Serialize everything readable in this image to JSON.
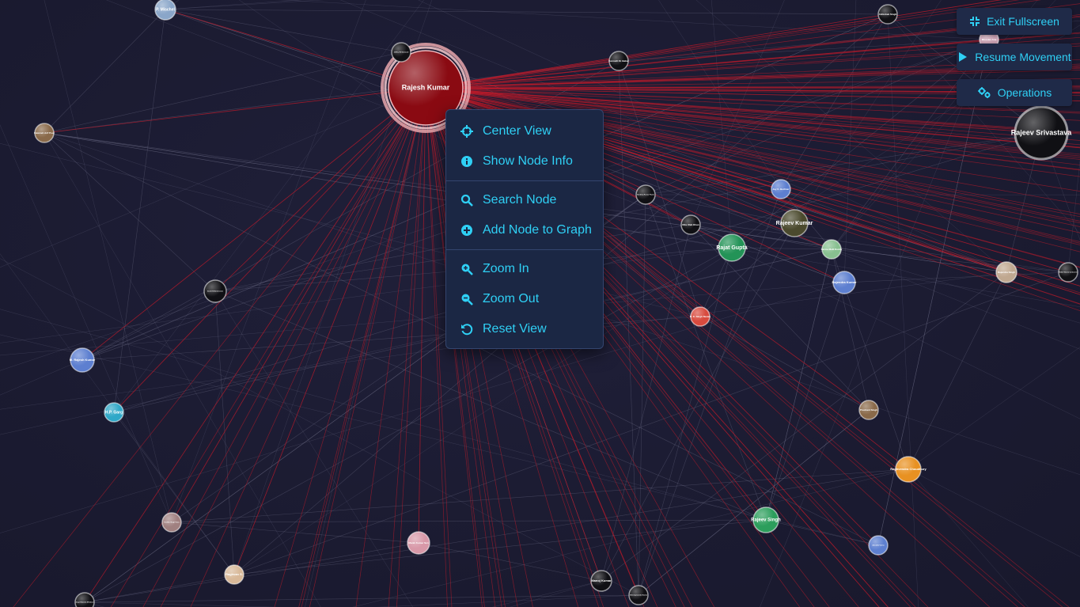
{
  "controls": {
    "exit_fullscreen": "Exit Fullscreen",
    "resume_movement": "Resume Movement",
    "operations": "Operations"
  },
  "context_menu": {
    "center_view": "Center View",
    "show_node_info": "Show Node Info",
    "search_node": "Search Node",
    "add_node": "Add Node to Graph",
    "zoom_in": "Zoom In",
    "zoom_out": "Zoom Out",
    "reset_view": "Reset View"
  },
  "selected_node": "Rajesh Kumar",
  "colors": {
    "accent": "#2fd0f5",
    "selected": "#8a0a12",
    "edge_highlight": "#c41a2a",
    "edge_default": "#7d7f99"
  },
  "nodes": [
    {
      "label": "Rajesh Kumar",
      "color": "#8a0a12"
    },
    {
      "label": "Rajeev Srivastava",
      "color": "#101014"
    },
    {
      "label": "P. Mischel",
      "color": "#8aa6c9"
    },
    {
      "label": "Abhishek Singh",
      "color": "#101014"
    },
    {
      "label": "Miroslav Ana",
      "color": "#c9a0b2"
    },
    {
      "label": "Jeffery M. Diamond",
      "color": "#101014"
    },
    {
      "label": "Kenneth M. Baker",
      "color": "#101014"
    },
    {
      "label": "Fatemeh Arif Pour",
      "color": "#8a6a4a"
    },
    {
      "label": "Sandeep Kumar Pawar",
      "color": "#101014"
    },
    {
      "label": "Jay K. Berliner",
      "color": "#5d7fd0"
    },
    {
      "label": "Rita Ulah Khan",
      "color": "#101014"
    },
    {
      "label": "Rajeev Kumar",
      "color": "#4b4a2e"
    },
    {
      "label": "Rajat Gupta",
      "color": "#239357"
    },
    {
      "label": "Sarma Malli Reddy",
      "color": "#88c090"
    },
    {
      "label": "Rajendra Kumar",
      "color": "#5d7fd0"
    },
    {
      "label": "Rajendra Singh",
      "color": "#c0a890"
    },
    {
      "label": "Rafael Garcia Carbonero",
      "color": "#101014"
    },
    {
      "label": "Asmit Srikanteswara",
      "color": "#101014"
    },
    {
      "label": "M. Rajesh Kumar",
      "color": "#5d7fd0"
    },
    {
      "label": "H.P. Garg",
      "color": "#2fa8c8"
    },
    {
      "label": "R. K. Singh Naram",
      "color": "#d84a3e"
    },
    {
      "label": "Prashant Singh",
      "color": "#8a6a4a"
    },
    {
      "label": "Raghvendra Choudhury",
      "color": "#e89122"
    },
    {
      "label": "Rajeev Singh",
      "color": "#2c9e5c"
    },
    {
      "label": "Anandita Varma",
      "color": "#5d7fd0"
    },
    {
      "label": "Yoshika Singh Yatus",
      "color": "#a08080"
    },
    {
      "label": "Manik Kumar Sen",
      "color": "#d898a8"
    },
    {
      "label": "Raghvan S.",
      "color": "#d8b898"
    },
    {
      "label": "Manoj Kumar",
      "color": "#101014"
    },
    {
      "label": "Chinmayananda Kumar",
      "color": "#101014"
    },
    {
      "label": "Jorge Eduardo Mendoza",
      "color": "#101014"
    }
  ]
}
